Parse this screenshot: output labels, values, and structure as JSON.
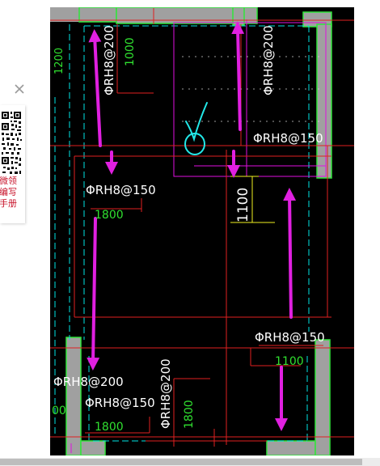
{
  "side_panel": {
    "line1": "微领",
    "line2": "编写",
    "line3": "手册"
  },
  "drawing": {
    "labels": {
      "rebar_top_vertical": "ΦRH8@200",
      "len_top_vertical": "1000",
      "rebar_top_right_vertical": "ΦRH8@200",
      "rebar_top_right": "ΦRH8@150",
      "dim_1100_vertical": "1100",
      "rebar_mid_left": "ΦRH8@150",
      "len_mid_left": "1800",
      "left_edge_dim": "1200",
      "rebar_right_lower": "ΦRH8@150",
      "len_right_lower": "1100",
      "rebar_bottom_left": "ΦRH8@200",
      "rebar_bottom_mid": "ΦRH8@150",
      "len_bottom_mid": "1800",
      "rebar_bottom_vertical": "ΦRH8@200",
      "len_bottom_vertical": "1800",
      "left_bottom_edge": "00"
    }
  }
}
